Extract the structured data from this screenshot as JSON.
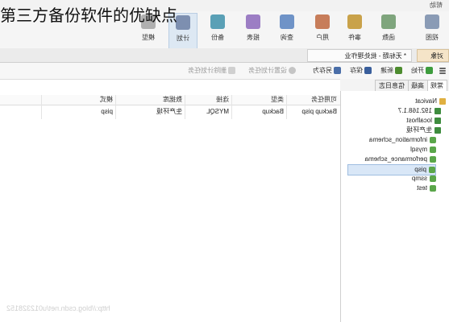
{
  "overlay_title": "第三方备份软件的优缺点",
  "titlebar": {
    "help": "帮助"
  },
  "toolbar": {
    "buttons": [
      {
        "label": "视图",
        "icon": "view-icon",
        "color": "#8a9bb5"
      },
      {
        "label": "函数",
        "icon": "function-icon",
        "color": "#7fa57d"
      },
      {
        "label": "事件",
        "icon": "event-icon",
        "color": "#c9a24a"
      },
      {
        "label": "用户",
        "icon": "user-icon",
        "color": "#c77d5a"
      },
      {
        "label": "查询",
        "icon": "query-icon",
        "color": "#6f93c7"
      },
      {
        "label": "报表",
        "icon": "report-icon",
        "color": "#9c7ec4"
      },
      {
        "label": "备份",
        "icon": "backup-icon",
        "color": "#5aa0b6"
      },
      {
        "label": "计划",
        "icon": "schedule-icon",
        "color": "#7d8fb0"
      },
      {
        "label": "模型",
        "icon": "model-icon",
        "color": "#b0b0b0"
      }
    ],
    "active_index": 7
  },
  "tabs": {
    "objects": "对象",
    "job": "* 无标题 - 批处理作业"
  },
  "actions": {
    "start": "开始",
    "new": "新建",
    "save": "保存",
    "save_as": "另存为",
    "set_schedule": "设置计划任务",
    "delete_schedule": "删除计划任务"
  },
  "left_tabs": {
    "general": "常规",
    "advanced": "高级",
    "message_log": "信息日志"
  },
  "tree": {
    "items": [
      {
        "label": "Navicat",
        "level": 0,
        "icon": "navicat-icon"
      },
      {
        "label": "192.168.1.7",
        "level": 1,
        "icon": "connection-icon"
      },
      {
        "label": "localhost",
        "level": 1,
        "icon": "connection-icon"
      },
      {
        "label": "生产环境",
        "level": 1,
        "icon": "connection-icon"
      },
      {
        "label": "information_schema",
        "level": 2,
        "icon": "database-icon"
      },
      {
        "label": "mysql",
        "level": 2,
        "icon": "database-icon"
      },
      {
        "label": "performance_schema",
        "level": 2,
        "icon": "database-icon"
      },
      {
        "label": "pisp",
        "level": 2,
        "icon": "database-icon",
        "selected": true
      },
      {
        "label": "ssmp",
        "level": 2,
        "icon": "database-icon"
      },
      {
        "label": "test",
        "level": 2,
        "icon": "database-icon"
      }
    ]
  },
  "grid": {
    "headers": [
      "可用任务",
      "类型",
      "连接",
      "数据库",
      "模式"
    ],
    "rows": [
      [
        "Backup pisp",
        "Backup",
        "MYSQL",
        "生产环境",
        "pisp"
      ]
    ]
  },
  "watermark": "http://blog.csdn.net/u012328152",
  "colors": {
    "active_tool": "#dde8f3",
    "objects_tab": "#f5e4c8",
    "selected_row": "#d9e7f7",
    "db_icon": "#5aa64a"
  }
}
